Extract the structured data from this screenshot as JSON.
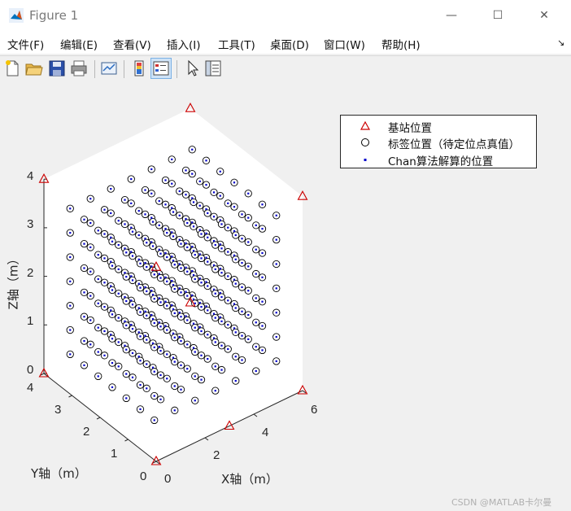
{
  "window": {
    "title": "Figure 1",
    "minimize_glyph": "—",
    "maximize_glyph": "☐",
    "close_glyph": "✕"
  },
  "menu": {
    "items": [
      "文件(F)",
      "编辑(E)",
      "查看(V)",
      "插入(I)",
      "工具(T)",
      "桌面(D)",
      "窗口(W)",
      "帮助(H)"
    ],
    "dock_glyph": "↘"
  },
  "toolbar": {
    "buttons": [
      "new-figure-icon",
      "open-file-icon",
      "save-icon",
      "print-icon",
      "link-plot-icon",
      "insert-colorbar-icon",
      "insert-legend-icon",
      "pointer-icon",
      "property-inspector-icon"
    ]
  },
  "legend": {
    "entries": [
      {
        "label": "基站位置",
        "marker": "triangle",
        "color": "#cc0000"
      },
      {
        "label": "标签位置（待定位点真值）",
        "marker": "circle",
        "color": "#000000"
      },
      {
        "label": "Chan算法解算的位置",
        "marker": "dot",
        "color": "#0000cc"
      }
    ]
  },
  "chart_data": {
    "type": "scatter3d",
    "title": "",
    "xlabel": "X轴（m）",
    "ylabel": "Y轴（m）",
    "zlabel": "Z轴（m）",
    "xlim": [
      0,
      6
    ],
    "ylim": [
      0,
      4
    ],
    "zlim": [
      0,
      4
    ],
    "xticks": [
      "0",
      "2",
      "4",
      "6"
    ],
    "yticks": [
      "0",
      "1",
      "2",
      "3",
      "4"
    ],
    "zticks": [
      "0",
      "1",
      "2",
      "3",
      "4"
    ],
    "series": [
      {
        "name": "基站位置",
        "marker": "triangle",
        "color": "#cc0000",
        "points": [
          [
            0,
            0,
            0
          ],
          [
            6,
            0,
            0
          ],
          [
            0,
            4,
            0
          ],
          [
            6,
            4,
            0
          ],
          [
            0,
            0,
            4
          ],
          [
            6,
            0,
            4
          ],
          [
            0,
            4,
            4
          ],
          [
            6,
            4,
            4
          ],
          [
            3,
            0,
            0
          ]
        ]
      },
      {
        "name": "标签位置（待定位点真值）",
        "marker": "circle",
        "color": "#000000",
        "grid": {
          "x": [
            0.5,
            5.5
          ],
          "y": [
            0.5,
            3.5
          ],
          "z": [
            0.5,
            3.5
          ],
          "n": 7
        }
      },
      {
        "name": "Chan算法解算的位置",
        "marker": "dot",
        "color": "#0000cc",
        "grid": {
          "x": [
            0.5,
            5.5
          ],
          "y": [
            0.5,
            3.5
          ],
          "z": [
            0.5,
            3.5
          ],
          "n": 7
        }
      }
    ]
  },
  "watermark": "CSDN @MATLAB卡尔曼"
}
